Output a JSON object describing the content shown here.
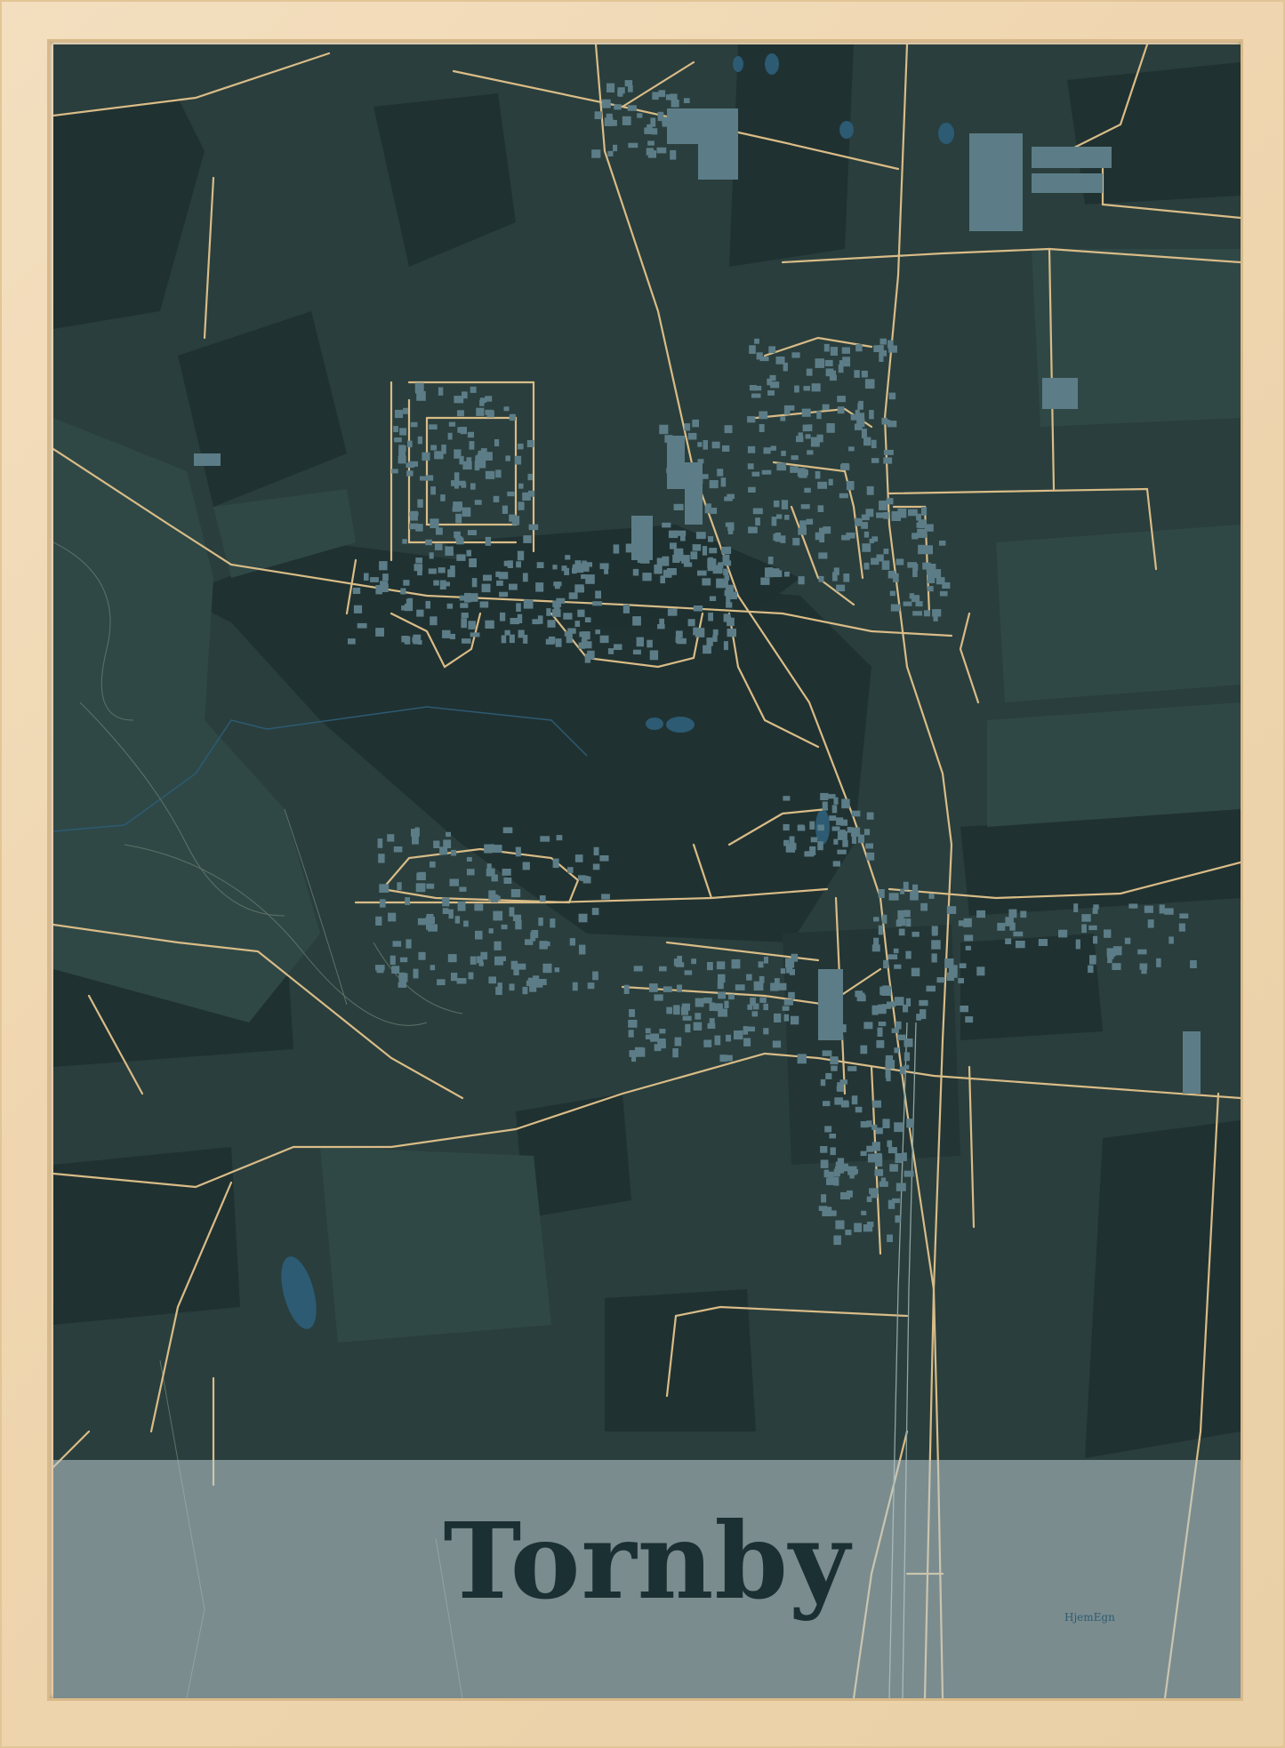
{
  "poster": {
    "title": "Tornby",
    "brand": "HjemEgn"
  },
  "colors": {
    "frame": "#efd6b0",
    "background": "#2a3e3d",
    "dark_fields": "#203131",
    "light_fields": "#2d4543",
    "buildings": "#5c7d87",
    "roads": "#d9bc87",
    "water": "#2c5b73",
    "title_band": "#bfccd2",
    "title_text": "#1b3032"
  },
  "map": {
    "features": [
      "fields",
      "roads",
      "buildings",
      "lakes",
      "railway",
      "streams"
    ]
  }
}
